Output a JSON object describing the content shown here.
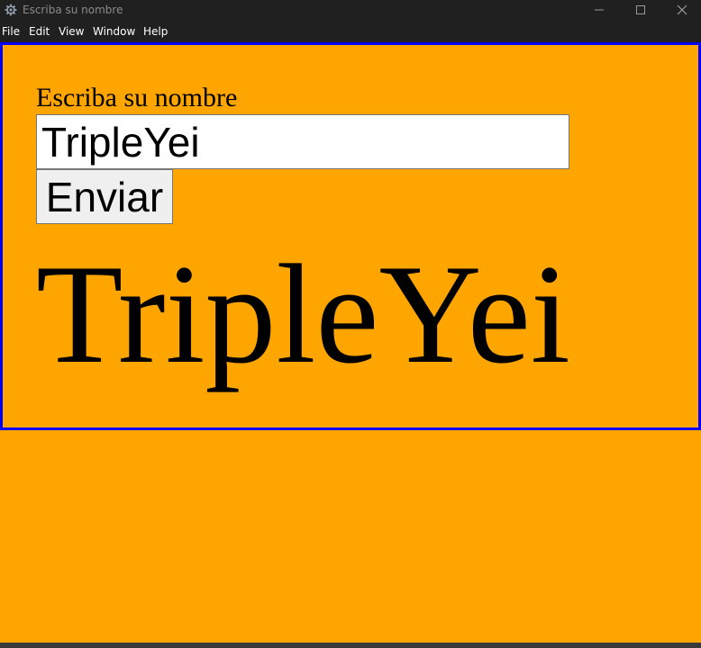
{
  "window": {
    "title": "Escriba su nombre"
  },
  "menu": {
    "items": [
      "File",
      "Edit",
      "View",
      "Window",
      "Help"
    ]
  },
  "form": {
    "label": "Escriba su nombre",
    "input_value": "TripleYei",
    "submit_label": "Enviar"
  },
  "output": {
    "display_name": "TripleYei"
  },
  "colors": {
    "background": "#ffa500",
    "frame_border": "#0000ff",
    "titlebar": "#202020"
  },
  "icons": {
    "app": "app-gear-icon",
    "minimize": "minimize-icon",
    "maximize": "maximize-icon",
    "close": "close-icon"
  }
}
